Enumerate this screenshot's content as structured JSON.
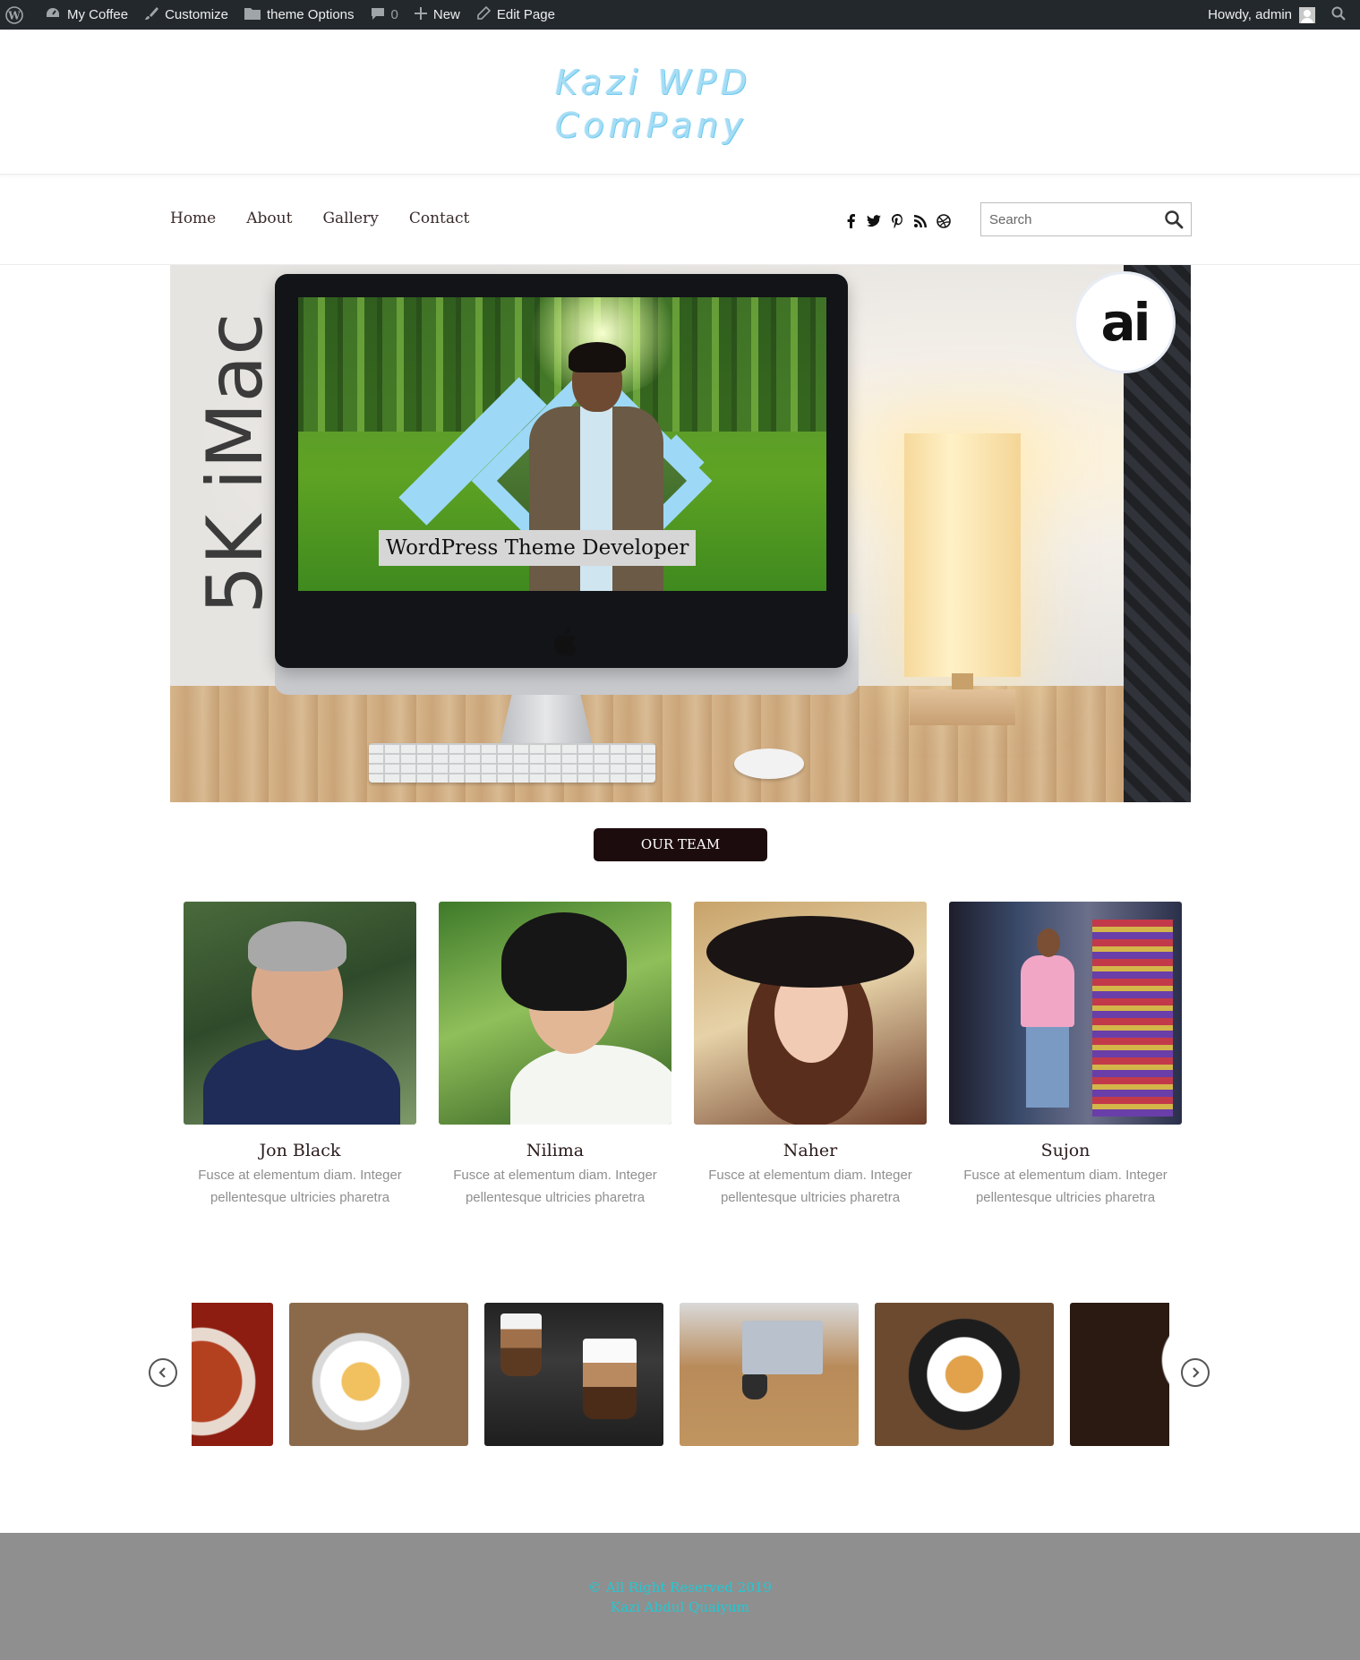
{
  "admin_bar": {
    "site_name": "My Coffee",
    "customize": "Customize",
    "theme_options": "theme Options",
    "comments_count": "0",
    "new": "New",
    "edit_page": "Edit Page",
    "greeting": "Howdy, admin"
  },
  "header": {
    "logo_line1": "Kazi WPD",
    "logo_line2": "ComPany"
  },
  "nav": {
    "items": [
      {
        "label": "Home"
      },
      {
        "label": "About"
      },
      {
        "label": "Gallery"
      },
      {
        "label": "Contact"
      }
    ],
    "social_icons": [
      "facebook-icon",
      "twitter-icon",
      "pinterest-icon",
      "rss-icon",
      "dribbble-icon"
    ],
    "search_placeholder": "Search"
  },
  "hero": {
    "vertical_text": "5K iMac",
    "badge_text": "ai",
    "caption": "WordPress Theme Developer"
  },
  "team": {
    "button_label": "OUR TEAM",
    "members": [
      {
        "name": "Jon Black",
        "desc_line1": "Fusce at elementum diam. Integer",
        "desc_line2": "pellentesque ultricies pharetra"
      },
      {
        "name": "Nilima",
        "desc_line1": "Fusce at elementum diam. Integer",
        "desc_line2": "pellentesque ultricies pharetra"
      },
      {
        "name": "Naher",
        "desc_line1": "Fusce at elementum diam. Integer",
        "desc_line2": "pellentesque ultricies pharetra"
      },
      {
        "name": "Sujon",
        "desc_line1": "Fusce at elementum diam. Integer",
        "desc_line2": "pellentesque ultricies pharetra"
      }
    ]
  },
  "footer": {
    "copyright": "© All Right Reserved 2019",
    "author": "Kazi Abdul Quaiyum"
  },
  "colors": {
    "admin_bar": "#23282d",
    "team_button": "#1d0c0e",
    "footer_bg": "#8f8f8f",
    "footer_text": "#21c9d4",
    "logo": "#a6dcf4"
  }
}
